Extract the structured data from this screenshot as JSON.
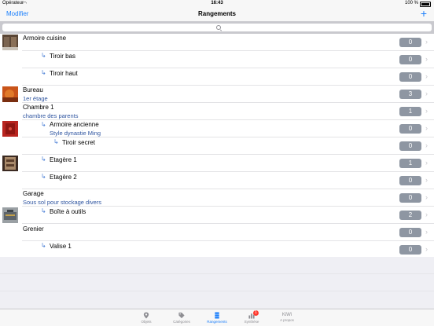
{
  "status": {
    "carrier": "Opérateur",
    "time": "16:43",
    "battery": "100 %"
  },
  "nav": {
    "edit": "Modifier",
    "title": "Rangements",
    "add": "+"
  },
  "rows": [
    {
      "title": "Armoire cuisine",
      "count": "0"
    },
    {
      "title": "Tiroir bas",
      "count": "0"
    },
    {
      "title": "Tiroir haut",
      "count": "0"
    },
    {
      "title": "Bureau",
      "subtitle": "1er étage",
      "count": "3"
    },
    {
      "title": "Chambre 1",
      "subtitle": "chambre des parents",
      "count": "1"
    },
    {
      "title": "Armoire ancienne",
      "subtitle": "Style dynastie Ming",
      "count": "0"
    },
    {
      "title": "Tiroir secret",
      "count": "0"
    },
    {
      "title": "Etagère 1",
      "count": "1"
    },
    {
      "title": "Etagère 2",
      "count": "0"
    },
    {
      "title": "Garage",
      "subtitle": "Sous sol pour stockage divers",
      "count": "0"
    },
    {
      "title": "Boîte à outils",
      "count": "2"
    },
    {
      "title": "Grenier",
      "count": "0"
    },
    {
      "title": "Valise 1",
      "count": "0"
    }
  ],
  "tabs": {
    "objets": "Objets",
    "categories": "Catégories",
    "rangements": "Rangements",
    "synthese": "Synthèse",
    "synthese_badge": "1",
    "kiwi": "KiWi",
    "apropos": "A propos"
  },
  "colors": {
    "accent": "#1a7efb",
    "count_bg": "#8e96a2",
    "subtitle": "#2f55a0"
  }
}
